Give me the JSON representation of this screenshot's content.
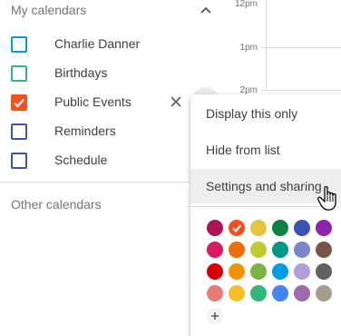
{
  "sidebar": {
    "section_title": "My calendars",
    "calendars": [
      {
        "label": "Charlie Danner",
        "color": "#039be5",
        "checked": false
      },
      {
        "label": "Birthdays",
        "color": "#33b679",
        "checked": false
      },
      {
        "label": "Public Events",
        "color": "#f4511e",
        "checked": true
      },
      {
        "label": "Reminders",
        "color": "#3f51b5",
        "checked": false
      },
      {
        "label": "Schedule",
        "color": "#3f51b5",
        "checked": false
      }
    ],
    "other_title": "Other calendars"
  },
  "time_grid": {
    "labels": [
      "12pm",
      "1pm",
      "2pm"
    ]
  },
  "menu": {
    "items": [
      "Display this only",
      "Hide from list",
      "Settings and sharing"
    ],
    "hovered_item": "Settings and sharing",
    "selected_color": "#f4511e",
    "colors": [
      [
        "#ad1457",
        "#f4511e",
        "#e4c441",
        "#0b8043",
        "#3f51b5",
        "#8e24aa"
      ],
      [
        "#d81b60",
        "#ef6c00",
        "#c0ca33",
        "#009688",
        "#7986cb",
        "#795548"
      ],
      [
        "#d50000",
        "#f09300",
        "#7cb342",
        "#039be5",
        "#b39ddb",
        "#616161"
      ],
      [
        "#e67c73",
        "#f6bf26",
        "#33b679",
        "#4285f4",
        "#9e69af",
        "#a79b8e"
      ]
    ],
    "add_label": "+"
  }
}
